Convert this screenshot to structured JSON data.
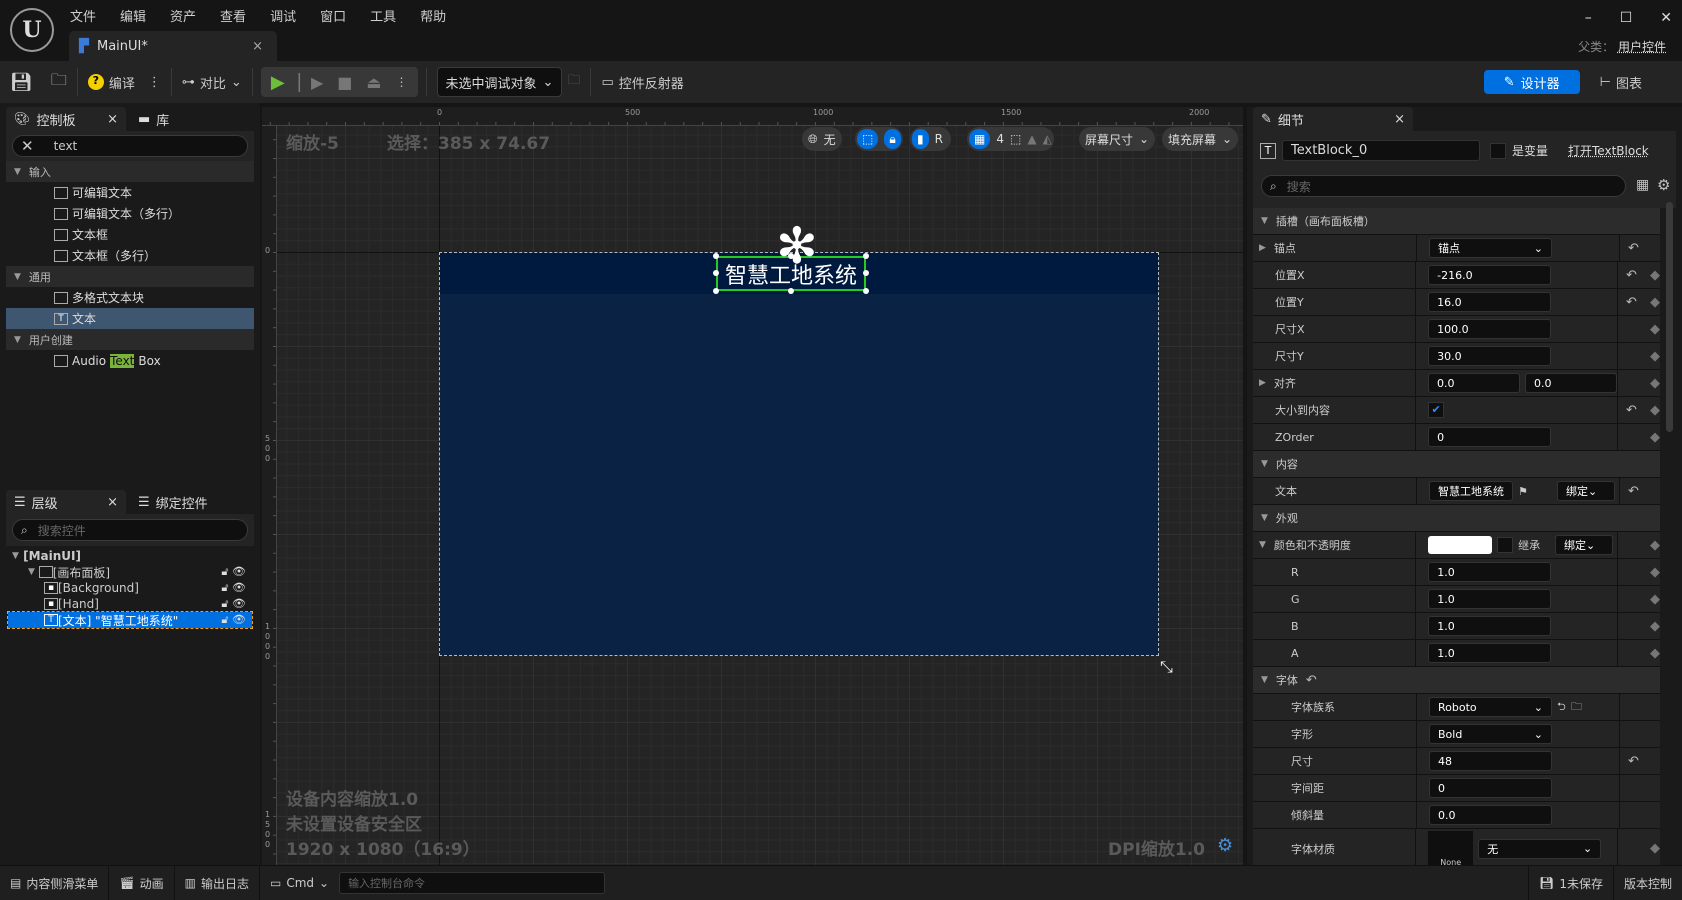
{
  "app": {
    "logo": "U",
    "menu": [
      "文件",
      "编辑",
      "资产",
      "查看",
      "调试",
      "窗口",
      "工具",
      "帮助"
    ],
    "tab": "MainUI*",
    "parent_label": "父类：",
    "parent_value": "用户控件"
  },
  "toolbar": {
    "compile": "编译",
    "diff": "对比",
    "debug_target": "未选中调试对象",
    "widget_reflector": "控件反射器",
    "designer": "设计器",
    "graph": "图表"
  },
  "palette": {
    "tab": "控制板",
    "library_tab": "库",
    "search_value": "text",
    "sections": [
      {
        "label": "输入",
        "items": [
          "可编辑文本",
          "可编辑文本（多行）",
          "文本框",
          "文本框（多行）"
        ]
      },
      {
        "label": "通用",
        "items": [
          "多格式文本块",
          "文本"
        ]
      },
      {
        "label": "用户创建",
        "items": [
          "Audio Text Box"
        ]
      }
    ],
    "selected_item": "文本",
    "highlight": "Text"
  },
  "hierarchy": {
    "tab": "层级",
    "binding_tab": "绑定控件",
    "search_placeholder": "搜索控件",
    "items": [
      "[MainUI]",
      "[画布面板]",
      "[Background]",
      "[Hand]",
      "[文本] \"智慧工地系统\""
    ]
  },
  "canvas": {
    "zoom": "缩放-5",
    "selection": "选择：385 x 74.67",
    "ruler_x": [
      "0",
      "500",
      "1000",
      "1500",
      "2000"
    ],
    "ruler_y": [
      "0",
      "500",
      "1000",
      "1500"
    ],
    "device_scale": "设备内容缩放1.0",
    "safe_zone": "未设置设备安全区",
    "resolution": "1920 x 1080（16:9）",
    "dpi": "DPI缩放1.0",
    "tb": {
      "none": "无",
      "r": "R",
      "grid": "4",
      "screen_size": "屏幕尺寸",
      "fill": "填充屏幕"
    },
    "text_block": "智慧工地系统",
    "bg_color": "#0a2244",
    "header_color": "#001a3f"
  },
  "details": {
    "tab": "细节",
    "name": "TextBlock_0",
    "is_variable": "是变量",
    "open": "打开TextBlock",
    "search_placeholder": "搜索",
    "rows": [
      {
        "type": "sec",
        "label": "插槽（画布面板槽）"
      },
      {
        "label": "锚点",
        "expand": true,
        "dropdown": "锚点",
        "reset": true
      },
      {
        "label": "位置X",
        "value": "-216.0",
        "reset": true,
        "key": true
      },
      {
        "label": "位置Y",
        "value": "16.0",
        "reset": true,
        "key": true
      },
      {
        "label": "尺寸X",
        "value": "100.0",
        "key": true
      },
      {
        "label": "尺寸Y",
        "value": "30.0",
        "key": true
      },
      {
        "label": "对齐",
        "expand": true,
        "value": "0.0",
        "value2": "0.0",
        "key": true
      },
      {
        "label": "大小到内容",
        "check": true,
        "reset": true,
        "key": true
      },
      {
        "label": "ZOrder",
        "value": "0",
        "key": true
      },
      {
        "type": "sec",
        "label": "内容"
      },
      {
        "label": "文本",
        "text": "智慧工地系统",
        "bind": "绑定",
        "reset": true
      },
      {
        "type": "sec",
        "label": "外观"
      },
      {
        "label": "颜色和不透明度",
        "open": true,
        "color": "#ffffff",
        "inherit": "继承",
        "bind": "绑定",
        "key": true
      },
      {
        "label": "R",
        "value": "1.0",
        "key": true,
        "indent": true
      },
      {
        "label": "G",
        "value": "1.0",
        "key": true,
        "indent": true
      },
      {
        "label": "B",
        "value": "1.0",
        "key": true,
        "indent": true
      },
      {
        "label": "A",
        "value": "1.0",
        "key": true,
        "indent": true
      },
      {
        "type": "sec",
        "label": "字体",
        "reset": true
      },
      {
        "label": "字体族系",
        "dropdown": "Roboto",
        "indent": true
      },
      {
        "label": "字形",
        "dropdown": "Bold",
        "indent": true
      },
      {
        "label": "尺寸",
        "value": "48",
        "reset": true,
        "indent": true
      },
      {
        "label": "字间距",
        "value": "0",
        "indent": true
      },
      {
        "label": "倾斜量",
        "value": "0.0",
        "indent": true
      },
      {
        "label": "字体材质",
        "thumb": "None",
        "dropdown": "无",
        "key": true,
        "indent": true,
        "tall": true
      }
    ]
  },
  "bottom": {
    "content_drawer": "内容侧滑菜单",
    "animation": "动画",
    "output_log": "输出日志",
    "cmd": "Cmd",
    "cmd_placeholder": "输入控制台命令",
    "unsaved": "1未保存",
    "source_control": "版本控制"
  }
}
